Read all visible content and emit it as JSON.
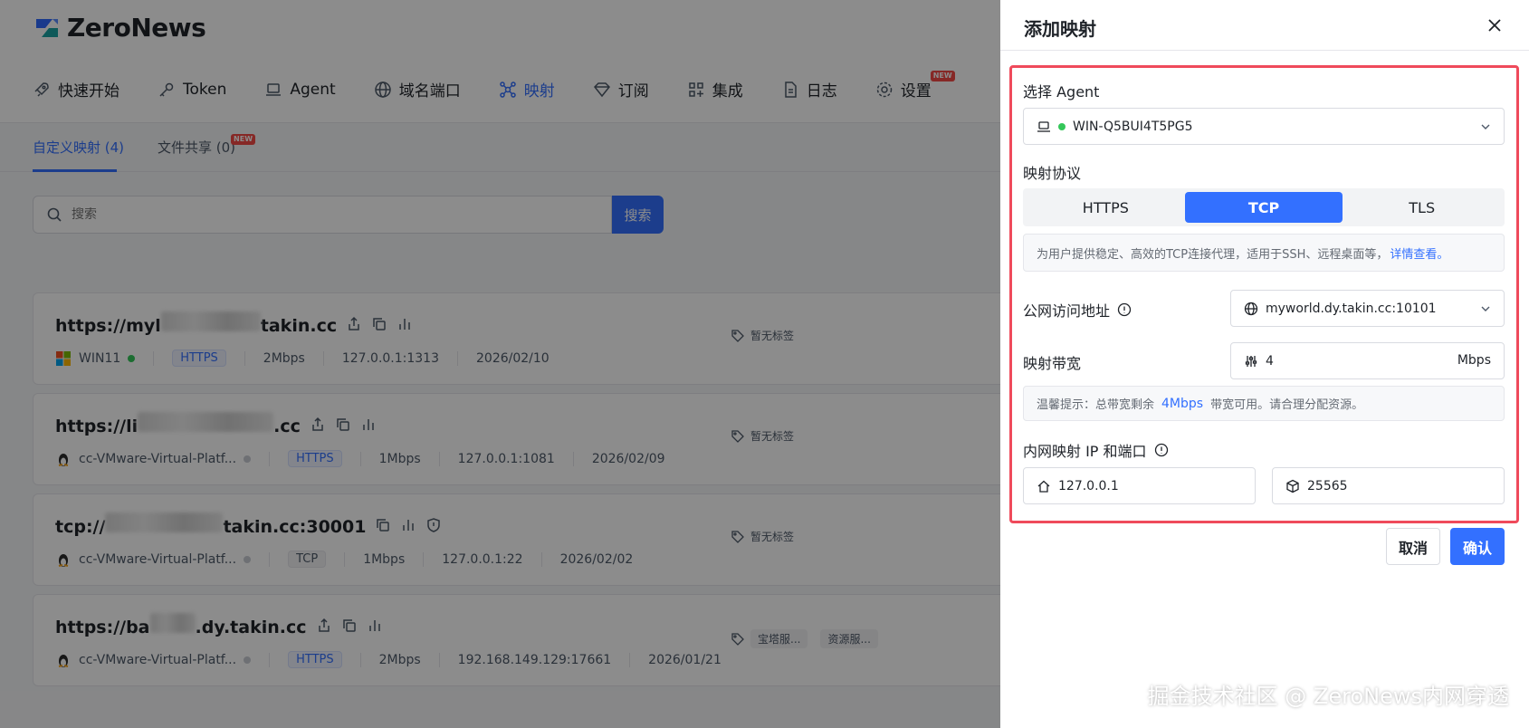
{
  "app": {
    "logo_text": "ZeroNews",
    "nav": [
      {
        "label": "快速开始",
        "icon": "rocket-icon"
      },
      {
        "label": "Token",
        "icon": "key-icon"
      },
      {
        "label": "Agent",
        "icon": "laptop-icon"
      },
      {
        "label": "域名端口",
        "icon": "globe-icon"
      },
      {
        "label": "映射",
        "icon": "network-icon",
        "active": true
      },
      {
        "label": "订阅",
        "icon": "diamond-icon"
      },
      {
        "label": "集成",
        "icon": "grid-icon"
      },
      {
        "label": "日志",
        "icon": "document-icon"
      },
      {
        "label": "设置",
        "icon": "gear-icon",
        "badge": "NEW"
      }
    ],
    "subtabs": [
      {
        "label": "自定义映射 (4)",
        "active": true
      },
      {
        "label": "文件共享 (0)",
        "badge": "NEW"
      }
    ],
    "search": {
      "placeholder": "搜索",
      "button": "搜索"
    },
    "cards": [
      {
        "title_prefix": "https://myl",
        "title_suffix": "takin.cc",
        "os": "windows",
        "agent": "WIN11",
        "status": "online",
        "protocol": "HTTPS",
        "bandwidth": "2Mbps",
        "local": "127.0.0.1:1313",
        "date": "2026/02/10",
        "tags": [
          "暂无标签"
        ]
      },
      {
        "title_prefix": "https://li",
        "title_suffix": ".cc",
        "os": "linux",
        "agent": "cc-VMware-Virtual-Platf...",
        "status": "offline",
        "protocol": "HTTPS",
        "bandwidth": "1Mbps",
        "local": "127.0.0.1:1081",
        "date": "2026/02/09",
        "tags": [
          "暂无标签"
        ]
      },
      {
        "title_prefix": "tcp://",
        "title_suffix": "takin.cc:30001",
        "os": "linux",
        "agent": "cc-VMware-Virtual-Platf...",
        "status": "offline",
        "protocol": "TCP",
        "bandwidth": "1Mbps",
        "local": "127.0.0.1:22",
        "date": "2026/02/02",
        "tags": [
          "暂无标签"
        ]
      },
      {
        "title_prefix": "https://ba",
        "title_suffix": ".dy.takin.cc",
        "os": "linux",
        "agent": "cc-VMware-Virtual-Platf...",
        "status": "offline",
        "protocol": "HTTPS",
        "bandwidth": "2Mbps",
        "local": "192.168.149.129:17661",
        "date": "2026/01/21",
        "tags": [
          "宝塔服...",
          "资源服..."
        ]
      }
    ]
  },
  "drawer": {
    "title": "添加映射",
    "agent_label": "选择 Agent",
    "agent_value": "WIN-Q5BUI4T5PG5",
    "protocol_label": "映射协议",
    "protocols": [
      "HTTPS",
      "TCP",
      "TLS"
    ],
    "active_protocol": "TCP",
    "protocol_hint": "为用户提供稳定、高效的TCP连接代理，适用于SSH、远程桌面等，",
    "protocol_hint_link": "详情查看。",
    "public_addr_label": "公网访问地址",
    "public_addr_value": "myworld.dy.takin.cc:10101",
    "bandwidth_label": "映射带宽",
    "bandwidth_value": "4",
    "bandwidth_unit": "Mbps",
    "bandwidth_hint_prefix": "温馨提示：总带宽剩余",
    "bandwidth_hint_value": "4Mbps",
    "bandwidth_hint_suffix": "带宽可用。请合理分配资源。",
    "inner_label": "内网映射 IP 和端口",
    "inner_ip": "127.0.0.1",
    "inner_port": "25565",
    "cancel": "取消",
    "confirm": "确认"
  },
  "watermark": "掘金技术社区 @ ZeroNews内网穿透",
  "colors": {
    "accent": "#3370ff",
    "highlight_border": "#ef4a5b",
    "online": "#34c759"
  }
}
